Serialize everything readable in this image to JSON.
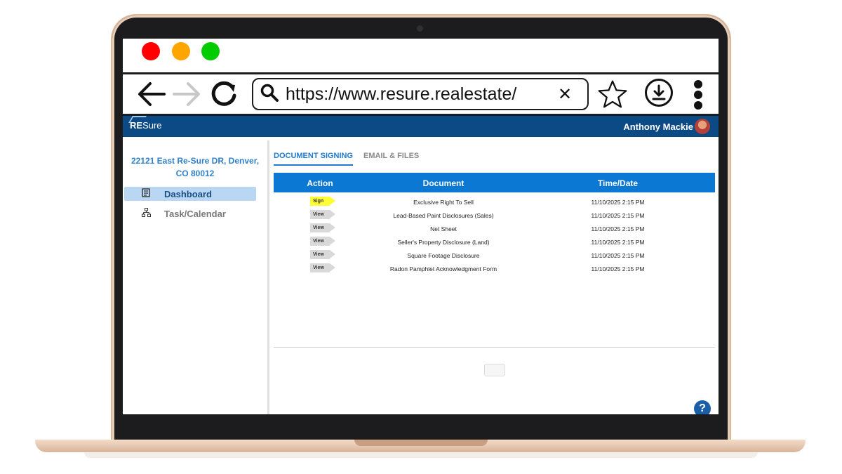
{
  "browser": {
    "url": "https://www.resure.realestate/",
    "back_glyph": "🡐",
    "forward_glyph": "🡒",
    "reload_glyph": "⟳",
    "clear_glyph": "✕",
    "star_glyph": "☆",
    "download_glyph": "⤓",
    "icons": [
      "back-arrow-icon",
      "forward-arrow-icon",
      "reload-icon",
      "search-icon",
      "clear-icon",
      "star-icon",
      "download-icon",
      "kebab-menu-icon"
    ],
    "dot_colors": [
      "#ff0000",
      "#ffa500",
      "#00cc00"
    ]
  },
  "app": {
    "logo_re": "RE",
    "logo_sure": "Sure",
    "user_name": "Anthony Mackie",
    "brand_color": "#0c4a85",
    "accent_color": "#0b78d4"
  },
  "sidebar": {
    "address": "22121 East Re-Sure DR, Denver, CO 80012",
    "items": [
      {
        "label": "Dashboard",
        "icon": "clipboard-icon",
        "glyph": "▤",
        "active": true
      },
      {
        "label": "Task/Calendar",
        "icon": "org-chart-icon",
        "glyph": "⧉",
        "active": false
      }
    ]
  },
  "tabs": [
    {
      "label": "DOCUMENT SIGNING",
      "active": true
    },
    {
      "label": "EMAIL & FILES",
      "active": false
    }
  ],
  "table": {
    "headers": [
      "Action",
      "Document",
      "Time/Date"
    ],
    "rows": [
      {
        "action": "Sign",
        "document": "Exclusive Right To Sell",
        "time": "11/10/2025 2:15 PM"
      },
      {
        "action": "View",
        "document": "Lead-Based Paint Disclosures (Sales)",
        "time": "11/10/2025 2:15 PM"
      },
      {
        "action": "View",
        "document": "Net Sheet",
        "time": "11/10/2025 2:15 PM"
      },
      {
        "action": "View",
        "document": "Seller's Property Disclosure (Land)",
        "time": "11/10/2025 2:15 PM"
      },
      {
        "action": "View",
        "document": "Square Footage Disclosure",
        "time": "11/10/2025 2:15 PM"
      },
      {
        "action": "View",
        "document": "Radon Pamphlet Acknowledgment Form",
        "time": "11/10/2025 2:15 PM"
      }
    ]
  },
  "help": {
    "glyph": "?"
  }
}
